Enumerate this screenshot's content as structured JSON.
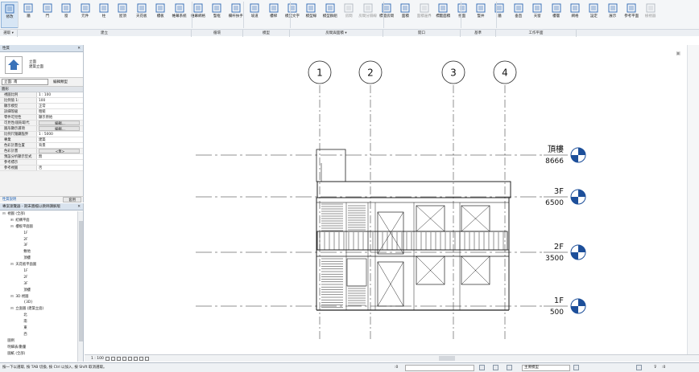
{
  "ribbon": {
    "buttons": [
      {
        "label": "修改",
        "icon": "cursor-icon",
        "active": true
      },
      {
        "label": "牆",
        "icon": "wall-icon"
      },
      {
        "label": "門",
        "icon": "door-icon"
      },
      {
        "label": "窗",
        "icon": "window-icon"
      },
      {
        "label": "元件",
        "icon": "component-icon"
      },
      {
        "label": "柱",
        "icon": "column-icon"
      },
      {
        "label": "屋頂",
        "icon": "roof-icon"
      },
      {
        "label": "天花板",
        "icon": "ceiling-icon"
      },
      {
        "label": "樓板",
        "icon": "floor-icon"
      },
      {
        "label": "帷幕系統",
        "icon": "curtain-system-icon"
      },
      {
        "label": "帷幕網格",
        "icon": "curtain-grid-icon"
      },
      {
        "label": "豎框",
        "icon": "mullion-icon"
      },
      {
        "label": "欄杆扶手",
        "icon": "railing-icon"
      },
      {
        "label": "坡道",
        "icon": "ramp-icon"
      },
      {
        "label": "樓梯",
        "icon": "stair-icon"
      },
      {
        "label": "模型文字",
        "icon": "model-text-icon"
      },
      {
        "label": "模型線",
        "icon": "model-line-icon"
      },
      {
        "label": "模型群組",
        "icon": "model-group-icon"
      },
      {
        "label": "房間",
        "icon": "room-icon",
        "disabled": true
      },
      {
        "label": "房間分隔線",
        "icon": "room-separator-icon",
        "disabled": true
      },
      {
        "label": "標籤房間",
        "icon": "tag-room-icon"
      },
      {
        "label": "面積",
        "icon": "area-icon"
      },
      {
        "label": "面積邊界",
        "icon": "area-boundary-icon",
        "disabled": true
      },
      {
        "label": "標籤面積",
        "icon": "tag-area-icon"
      },
      {
        "label": "依面",
        "icon": "by-face-icon"
      },
      {
        "label": "豎井",
        "icon": "shaft-icon"
      },
      {
        "label": "牆",
        "icon": "wall-opening-icon"
      },
      {
        "label": "垂直",
        "icon": "vertical-opening-icon"
      },
      {
        "label": "天窗",
        "icon": "dormer-icon"
      },
      {
        "label": "樓層",
        "icon": "level-icon"
      },
      {
        "label": "網格",
        "icon": "grid-icon"
      },
      {
        "label": "設定",
        "icon": "set-icon"
      },
      {
        "label": "展示",
        "icon": "show-icon"
      },
      {
        "label": "參考平面",
        "icon": "ref-plane-icon"
      },
      {
        "label": "檢視器",
        "icon": "viewer-icon",
        "disabled": true
      }
    ],
    "panels": [
      {
        "label": "選取 ▾",
        "w": 22
      },
      {
        "label": "建立",
        "w": 216
      },
      {
        "label": "循環",
        "w": 64
      },
      {
        "label": "模型",
        "w": 58
      },
      {
        "label": "房間與面積 ▾",
        "w": 116
      },
      {
        "label": "開口",
        "w": 96
      },
      {
        "label": "基準",
        "w": 44
      },
      {
        "label": "工作平面",
        "w": 100
      }
    ]
  },
  "properties": {
    "title": "性質",
    "type_name_1": "立面",
    "type_name_2": "建築立面",
    "filter_value": "立面: 南",
    "edit_type": "編輯類型",
    "section": "圖形",
    "rows": [
      {
        "k": "視圖比例",
        "v": "1 : 100"
      },
      {
        "k": "比例值 1:",
        "v": "100"
      },
      {
        "k": "顯示模型",
        "v": "正常"
      },
      {
        "k": "詳細等級",
        "v": "粗糙"
      },
      {
        "k": "零件可見性",
        "v": "顯示原始"
      },
      {
        "k": "可見性/圖形取代",
        "v": "編輯...",
        "btn": true
      },
      {
        "k": "圖形顯示選項",
        "v": "編輯...",
        "btn": true
      },
      {
        "k": "比例尺隱藏臨界",
        "v": "1 : 5000"
      },
      {
        "k": "專業",
        "v": "建築"
      },
      {
        "k": "色彩計畫位置",
        "v": "背景"
      },
      {
        "k": "色彩計畫",
        "v": "<無>",
        "btn": true
      },
      {
        "k": "預設分析顯示型式",
        "v": "無"
      },
      {
        "k": "參考標示",
        "v": ""
      },
      {
        "k": "參考視圖",
        "v": "否"
      }
    ],
    "help_link": "性質說明",
    "apply": "套用"
  },
  "browser": {
    "title": "專案瀏覽器 - 期末圖檔以教師講解版",
    "items": [
      {
        "t": "視圖 (全部)",
        "lvl": 0,
        "tg": "⊟"
      },
      {
        "t": "結構平面",
        "lvl": 1,
        "tg": "⊞"
      },
      {
        "t": "樓板平面圖",
        "lvl": 1,
        "tg": "⊟"
      },
      {
        "t": "1F",
        "lvl": 2,
        "tg": ""
      },
      {
        "t": "2F",
        "lvl": 2,
        "tg": ""
      },
      {
        "t": "3F",
        "lvl": 2,
        "tg": ""
      },
      {
        "t": "敷地",
        "lvl": 2,
        "tg": ""
      },
      {
        "t": "頂樓",
        "lvl": 2,
        "tg": ""
      },
      {
        "t": "天花板平面圖",
        "lvl": 1,
        "tg": "⊟"
      },
      {
        "t": "1F",
        "lvl": 2,
        "tg": ""
      },
      {
        "t": "2F",
        "lvl": 2,
        "tg": ""
      },
      {
        "t": "3F",
        "lvl": 2,
        "tg": ""
      },
      {
        "t": "頂樓",
        "lvl": 2,
        "tg": ""
      },
      {
        "t": "3D 視圖",
        "lvl": 1,
        "tg": "⊟"
      },
      {
        "t": "{3D}",
        "lvl": 2,
        "tg": ""
      },
      {
        "t": "立面圖 (建築立面)",
        "lvl": 1,
        "tg": "⊟"
      },
      {
        "t": "北",
        "lvl": 2,
        "tg": ""
      },
      {
        "t": "南",
        "lvl": 2,
        "tg": ""
      },
      {
        "t": "東",
        "lvl": 2,
        "tg": ""
      },
      {
        "t": "西",
        "lvl": 2,
        "tg": ""
      },
      {
        "t": "圖例",
        "lvl": 0,
        "tg": ""
      },
      {
        "t": "明細表/數量",
        "lvl": 0,
        "tg": ""
      },
      {
        "t": "圖紙 (全部)",
        "lvl": 0,
        "tg": ""
      }
    ]
  },
  "grids": [
    "1",
    "2",
    "3",
    "4"
  ],
  "levels": [
    {
      "name": "頂樓",
      "elev": "8666"
    },
    {
      "name": "3F",
      "elev": "6500"
    },
    {
      "name": "2F",
      "elev": "3500"
    },
    {
      "name": "1F",
      "elev": "500"
    }
  ],
  "viewbar": {
    "scale": "1 : 100"
  },
  "status": {
    "text": "按一下以選取, 按 TAB 切換, 按 Ctrl 以加入, 按 Shift 取消選取。",
    "zero": ":0",
    "workset": "主要模型",
    "filter_count": ":0"
  }
}
